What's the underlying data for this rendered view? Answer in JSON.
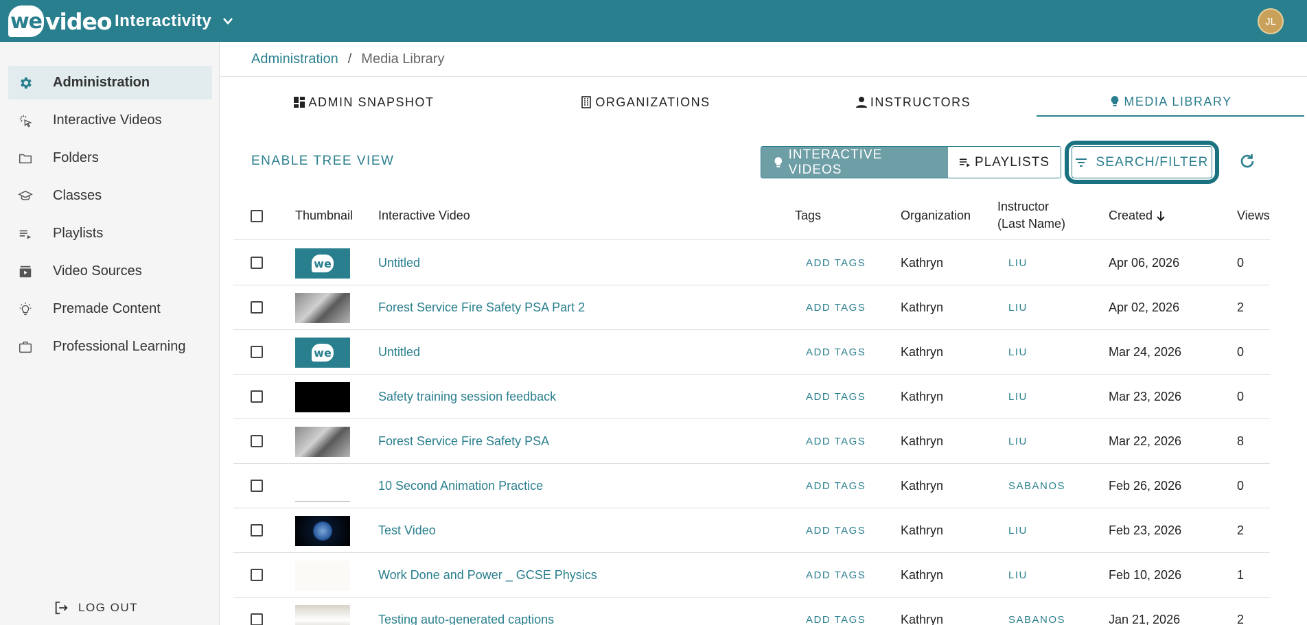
{
  "header": {
    "logo_we": "we",
    "logo_video": "video",
    "app_name": "Interactivity",
    "avatar_initials": "JL"
  },
  "sidebar": {
    "items": [
      {
        "label": "Administration",
        "icon": "gear-icon",
        "active": true
      },
      {
        "label": "Interactive Videos",
        "icon": "cursor-click-icon"
      },
      {
        "label": "Folders",
        "icon": "folder-icon"
      },
      {
        "label": "Classes",
        "icon": "graduation-cap-icon"
      },
      {
        "label": "Playlists",
        "icon": "playlist-icon"
      },
      {
        "label": "Video Sources",
        "icon": "video-library-icon"
      },
      {
        "label": "Premade Content",
        "icon": "lightbulb-icon"
      },
      {
        "label": "Professional Learning",
        "icon": "briefcase-icon"
      }
    ],
    "logout_label": "LOG OUT"
  },
  "breadcrumb": {
    "parent": "Administration",
    "separator": "/",
    "current": "Media Library"
  },
  "tabs": [
    {
      "label": "ADMIN SNAPSHOT",
      "icon": "dashboard-icon"
    },
    {
      "label": "ORGANIZATIONS",
      "icon": "building-icon"
    },
    {
      "label": "INSTRUCTORS",
      "icon": "person-icon"
    },
    {
      "label": "MEDIA LIBRARY",
      "icon": "lightbulb-icon",
      "active": true
    }
  ],
  "toolbar": {
    "tree_view_label": "ENABLE TREE VIEW",
    "interactive_videos_label": "INTERACTIVE VIDEOS",
    "playlists_label": "PLAYLISTS",
    "search_filter_label": "SEARCH/FILTER"
  },
  "table": {
    "headers": {
      "thumbnail": "Thumbnail",
      "video": "Interactive Video",
      "tags": "Tags",
      "organization": "Organization",
      "instructor_line1": "Instructor",
      "instructor_line2": "(Last Name)",
      "created": "Created",
      "views": "Views"
    },
    "rows": [
      {
        "title": "Untitled",
        "tags": "ADD TAGS",
        "org": "Kathryn",
        "instructor": "LIU",
        "created": "Apr 06, 2026",
        "views": "0",
        "thumb": "we"
      },
      {
        "title": "Forest Service Fire Safety PSA Part 2",
        "tags": "ADD TAGS",
        "org": "Kathryn",
        "instructor": "LIU",
        "created": "Apr 02, 2026",
        "views": "2",
        "thumb": "forest"
      },
      {
        "title": "Untitled",
        "tags": "ADD TAGS",
        "org": "Kathryn",
        "instructor": "LIU",
        "created": "Mar 24, 2026",
        "views": "0",
        "thumb": "we"
      },
      {
        "title": "Safety training session feedback",
        "tags": "ADD TAGS",
        "org": "Kathryn",
        "instructor": "LIU",
        "created": "Mar 23, 2026",
        "views": "0",
        "thumb": "black"
      },
      {
        "title": "Forest Service Fire Safety PSA",
        "tags": "ADD TAGS",
        "org": "Kathryn",
        "instructor": "LIU",
        "created": "Mar 22, 2026",
        "views": "8",
        "thumb": "forest"
      },
      {
        "title": "10 Second Animation Practice",
        "tags": "ADD TAGS",
        "org": "Kathryn",
        "instructor": "SABANOS",
        "created": "Feb 26, 2026",
        "views": "0",
        "thumb": "anim"
      },
      {
        "title": "Test Video",
        "tags": "ADD TAGS",
        "org": "Kathryn",
        "instructor": "LIU",
        "created": "Feb 23, 2026",
        "views": "2",
        "thumb": "earth"
      },
      {
        "title": "Work Done and Power _ GCSE Physics",
        "tags": "ADD TAGS",
        "org": "Kathryn",
        "instructor": "LIU",
        "created": "Feb 10, 2026",
        "views": "1",
        "thumb": "physics"
      },
      {
        "title": "Testing auto-generated captions",
        "tags": "ADD TAGS",
        "org": "Kathryn",
        "instructor": "SABANOS",
        "created": "Jan 21, 2026",
        "views": "2",
        "thumb": "captions"
      }
    ]
  },
  "colors": {
    "brand": "#2a7f8e",
    "highlight_ring": "#1a7180"
  }
}
